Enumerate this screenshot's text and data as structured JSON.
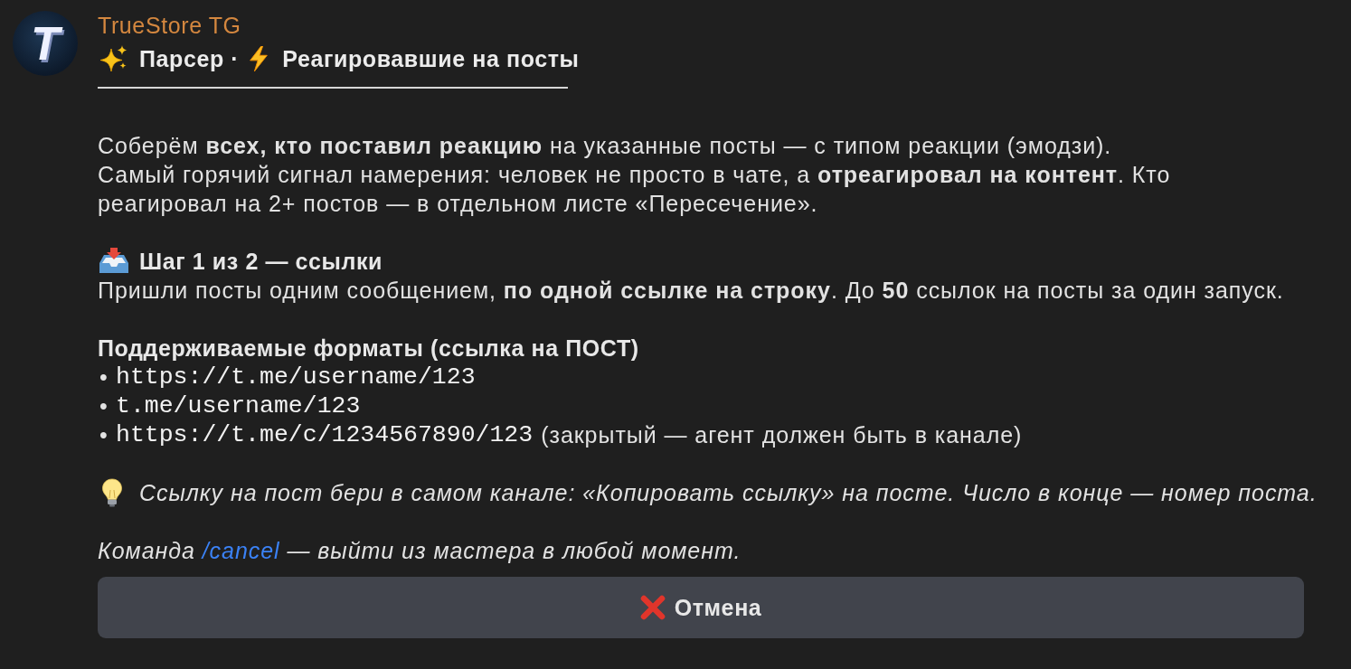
{
  "message": {
    "avatar_letter": "T",
    "sender": "TrueStore TG",
    "title": [
      "Парсер ·",
      "Реагировавшие на посты"
    ],
    "intro": [
      "Соберём **всех, кто поставил реакцию** на указанные посты — с типом реакции (эмодзи).",
      "Самый горячий сигнал намерения: человек не просто в чате, а **отреагировал на контент**. Кто\nреагировал на 2+ постов — в отдельном листе «Пересечение»."
    ],
    "step_heading": "Шаг 1 из 2 — ссылки",
    "step_text": "Пришли посты одним сообщением, **по одной ссылке на строку**. До **50** ссылок на посты за один запуск.",
    "formats_heading": "Поддерживаемые форматы (ссылка на ПОСТ)",
    "formats": [
      {
        "bullet": "•",
        "url": "https://t.me/username/123"
      },
      {
        "bullet": "•",
        "url": "t.me/username/123"
      },
      {
        "bullet": "•",
        "url": "https://t.me/c/1234567890/123",
        "note": "(закрытый — агент должен быть в канале)"
      }
    ],
    "tip": "Ссылку на пост бери в самом канале: «Копировать ссылку» на посте. Число в конце — номер поста.",
    "cancel_hint": {
      "before": "Команда ",
      "command": "/cancel",
      "after": " — выйти из мастера в любой момент."
    }
  },
  "buttons": [
    {
      "label": "Отмена"
    }
  ]
}
